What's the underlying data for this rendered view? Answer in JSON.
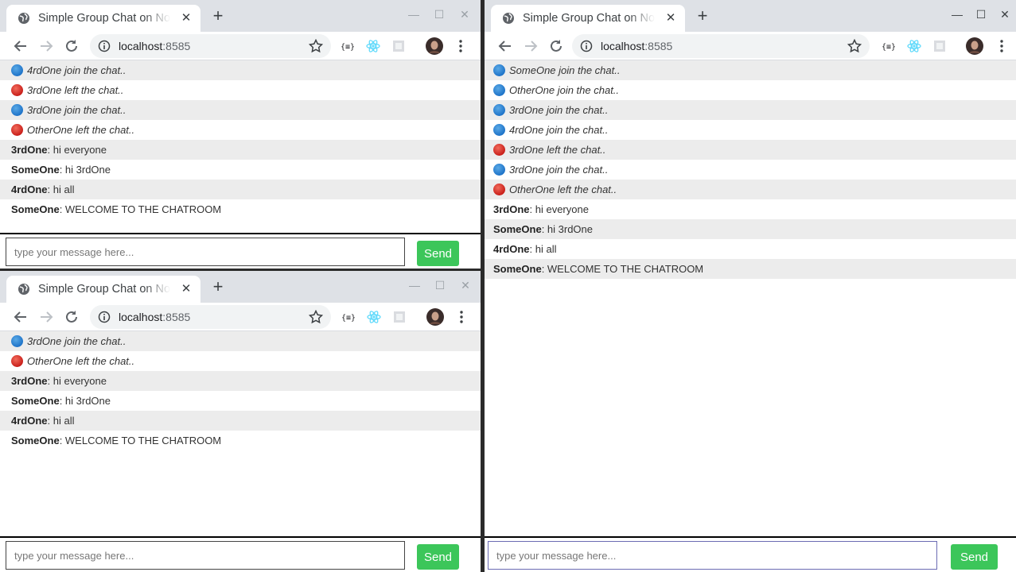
{
  "browser": {
    "tab_title": "Simple Group Chat on Node.js",
    "tab_close": "✕",
    "new_tab": "+",
    "url_host": "localhost",
    "url_port": ":8585",
    "window_controls": {
      "minimize": "—",
      "maximize": "☐",
      "close": "✕"
    }
  },
  "composer": {
    "placeholder": "type your message here...",
    "send_label": "Send"
  },
  "windows": {
    "top_left": {
      "messages": [
        {
          "type": "event",
          "status": "join",
          "text": "4rdOne join the chat.."
        },
        {
          "type": "event",
          "status": "leave",
          "text": "3rdOne left the chat.."
        },
        {
          "type": "event",
          "status": "join",
          "text": "3rdOne join the chat.."
        },
        {
          "type": "event",
          "status": "leave",
          "text": "OtherOne left the chat.."
        },
        {
          "type": "chat",
          "user": "3rdOne",
          "text": ": hi everyone"
        },
        {
          "type": "chat",
          "user": "SomeOne",
          "text": ": hi 3rdOne"
        },
        {
          "type": "chat",
          "user": "4rdOne",
          "text": ": hi all"
        },
        {
          "type": "chat",
          "user": "SomeOne",
          "text": ": WELCOME TO THE CHATROOM"
        }
      ]
    },
    "bottom_left": {
      "messages": [
        {
          "type": "event",
          "status": "join",
          "text": "3rdOne join the chat.."
        },
        {
          "type": "event",
          "status": "leave",
          "text": "OtherOne left the chat.."
        },
        {
          "type": "chat",
          "user": "3rdOne",
          "text": ": hi everyone"
        },
        {
          "type": "chat",
          "user": "SomeOne",
          "text": ": hi 3rdOne"
        },
        {
          "type": "chat",
          "user": "4rdOne",
          "text": ": hi all"
        },
        {
          "type": "chat",
          "user": "SomeOne",
          "text": ": WELCOME TO THE CHATROOM"
        }
      ]
    },
    "right": {
      "messages": [
        {
          "type": "event",
          "status": "join",
          "text": "SomeOne join the chat.."
        },
        {
          "type": "event",
          "status": "join",
          "text": "OtherOne join the chat.."
        },
        {
          "type": "event",
          "status": "join",
          "text": "3rdOne join the chat.."
        },
        {
          "type": "event",
          "status": "join",
          "text": "4rdOne join the chat.."
        },
        {
          "type": "event",
          "status": "leave",
          "text": "3rdOne left the chat.."
        },
        {
          "type": "event",
          "status": "join",
          "text": "3rdOne join the chat.."
        },
        {
          "type": "event",
          "status": "leave",
          "text": "OtherOne left the chat.."
        },
        {
          "type": "chat",
          "user": "3rdOne",
          "text": ": hi everyone"
        },
        {
          "type": "chat",
          "user": "SomeOne",
          "text": ": hi 3rdOne"
        },
        {
          "type": "chat",
          "user": "4rdOne",
          "text": ": hi all"
        },
        {
          "type": "chat",
          "user": "SomeOne",
          "text": ": WELCOME TO THE CHATROOM"
        }
      ]
    }
  },
  "colors": {
    "send_button": "#3cc65a",
    "join_dot": "#1f74c9",
    "leave_dot": "#c9201b",
    "tab_strip": "#dee1e6"
  },
  "icons": [
    "globe-icon",
    "close-icon",
    "plus-icon",
    "back-arrow-icon",
    "forward-arrow-icon",
    "reload-icon",
    "info-icon",
    "star-icon",
    "json-extension-icon",
    "react-devtools-icon",
    "extension-icon",
    "profile-avatar",
    "kebab-menu-icon",
    "minimize-icon",
    "maximize-icon"
  ]
}
